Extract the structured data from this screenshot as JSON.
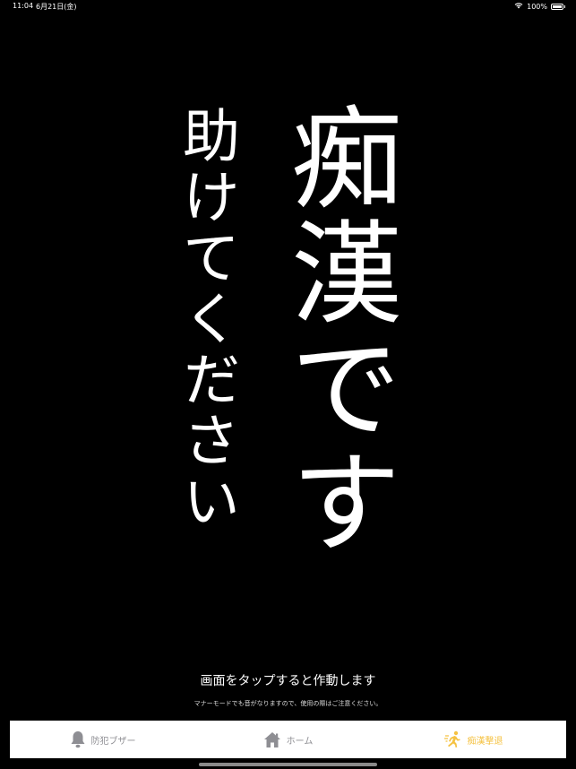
{
  "status_bar": {
    "time": "11:04",
    "date": "6月21日(金)",
    "battery": "100%"
  },
  "main": {
    "message": "痴漢です",
    "sub_message": "助けてください",
    "instruction": "画面をタップすると作動します",
    "caution": "マナーモードでも音がなりますので、使用の際はご注意ください。"
  },
  "tabs": [
    {
      "label": "防犯ブザー",
      "icon": "bell-icon",
      "active": false
    },
    {
      "label": "ホーム",
      "icon": "home-icon",
      "active": false
    },
    {
      "label": "痴漢撃退",
      "icon": "running-person-icon",
      "active": true
    }
  ],
  "colors": {
    "background": "#000000",
    "active_tab": "#f5c242",
    "inactive_tab": "#8e8e93"
  }
}
